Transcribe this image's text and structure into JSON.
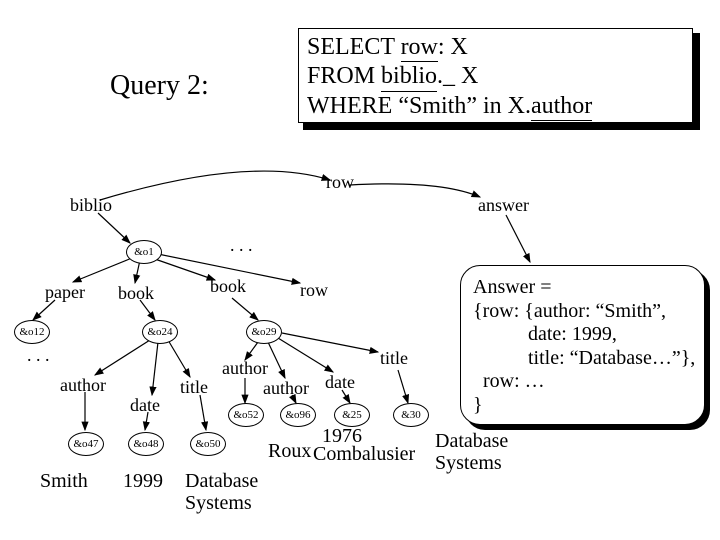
{
  "title": "Query 2:",
  "query": {
    "line1_a": "SELECT ",
    "line1_u": "row",
    "line1_b": ": X",
    "line2_a": "FROM ",
    "line2_u": "biblio",
    "line2_b": "._ X",
    "line3_a": "WHERE “Smith” in X.",
    "line3_u": "author"
  },
  "labels": {
    "biblio": "biblio",
    "row_top": "row",
    "answer_label": "answer",
    "dots_top": ".  .  .",
    "paper": "paper",
    "book1": "book",
    "book2": "book",
    "row_mid": "row",
    "dots_left": ".  .  .",
    "author1": "author",
    "date": "date",
    "title1": "title",
    "author2": "author",
    "author3": "author",
    "date2": "date",
    "title2": "title",
    "smith": "Smith",
    "year1": "1999",
    "db1": "Database\nSystems",
    "roux": "Roux",
    "year2": "1976",
    "comb": "Combalusier",
    "db2": "Database\nSystems"
  },
  "nodes": {
    "o1": "&o1",
    "o12": "&o12",
    "o24": "&o24",
    "o29": "&o29",
    "o47": "&o47",
    "o48": "&o48",
    "o50": "&o50",
    "o52": "&o52",
    "o96": "&o96",
    "n25": "&25",
    "n30": "&30"
  },
  "answer_text": "Answer =\n{row: {author: “Smith”,\n           date: 1999,\n           title: “Database…”},\n  row: …\n}"
}
